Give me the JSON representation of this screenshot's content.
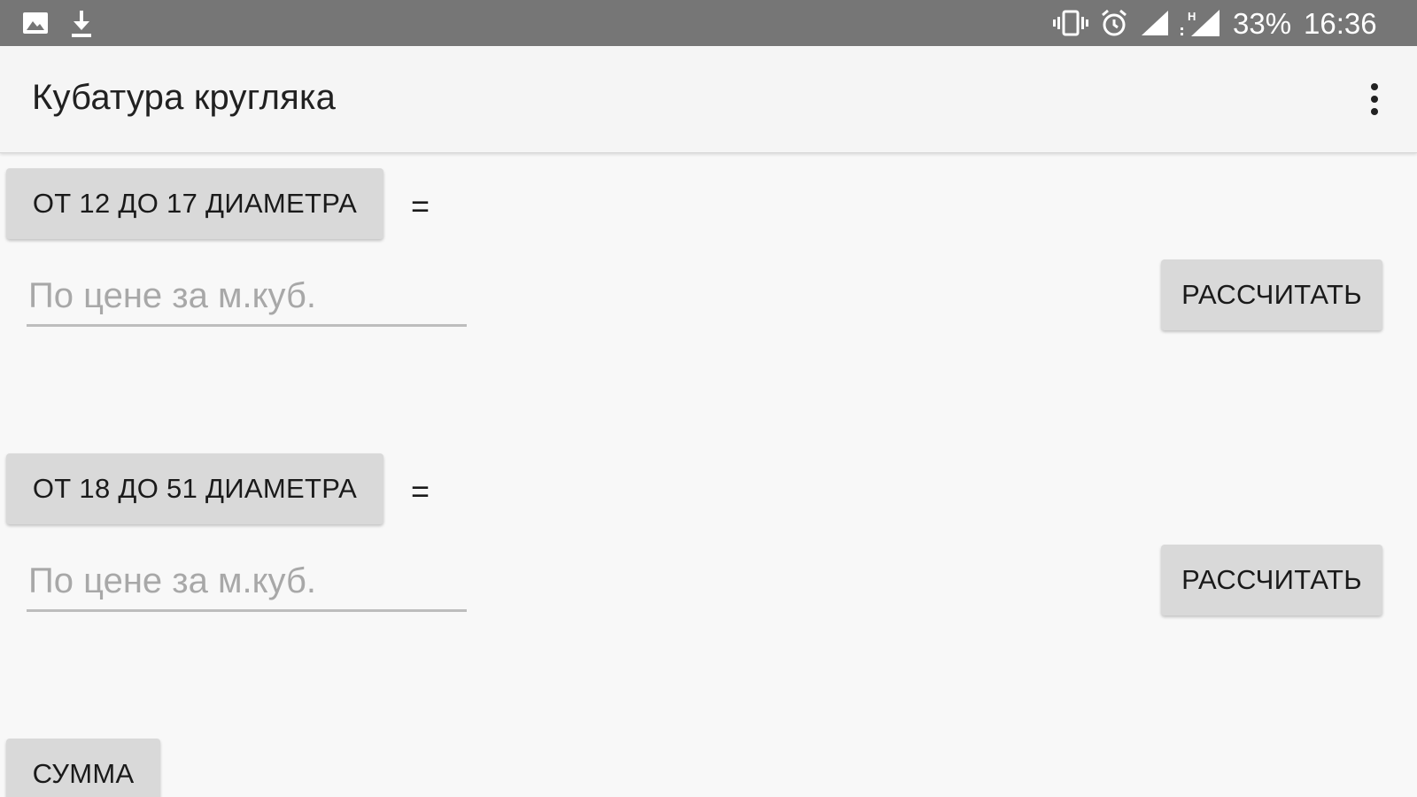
{
  "status_bar": {
    "battery": "33%",
    "time": "16:36",
    "icons": [
      "image-icon",
      "download-icon",
      "vibrate-icon",
      "alarm-icon",
      "signal-icon",
      "signal-h-icon"
    ]
  },
  "app_bar": {
    "title": "Кубатура кругляка",
    "menu_icon": "more-vert-icon"
  },
  "sections": [
    {
      "range_label": "ОТ 12 ДО 17 ДИАМЕТРА",
      "equals": "=",
      "price_placeholder": "По цене за м.куб.",
      "calc_label": "РАССЧИТАТЬ"
    },
    {
      "range_label": "ОТ 18 ДО 51 ДИАМЕТРА",
      "equals": "=",
      "price_placeholder": "По цене за м.куб.",
      "calc_label": "РАССЧИТАТЬ"
    }
  ],
  "sum_label": "СУММА",
  "colors": {
    "status_bar": "#767676",
    "app_bar": "#f5f5f5",
    "background": "#f8f8f8",
    "button": "#d9d9d9",
    "hint_text": "#a8a8a8",
    "text": "#212121"
  }
}
